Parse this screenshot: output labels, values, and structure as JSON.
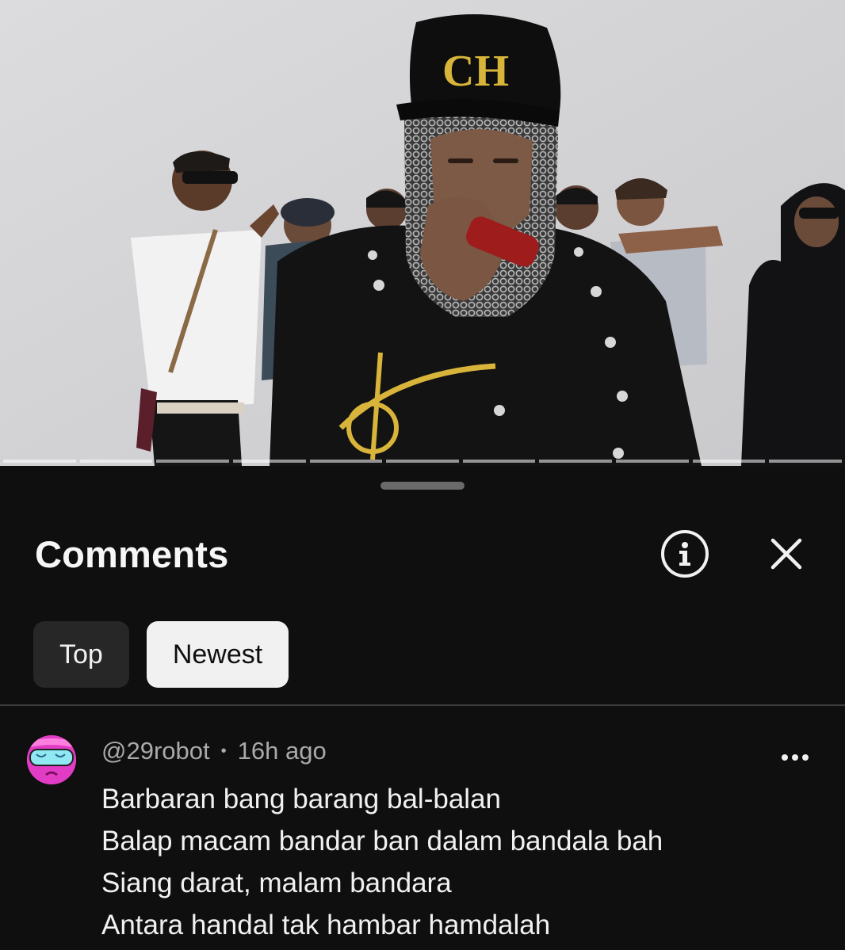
{
  "video": {
    "cap_logo": "CH"
  },
  "comments_panel": {
    "title": "Comments",
    "info_icon": "info-circle-icon",
    "close_icon": "close-x-icon",
    "sort_chips": [
      {
        "label": "Top",
        "selected": false
      },
      {
        "label": "Newest",
        "selected": true
      }
    ],
    "comment": {
      "author": "@29robot",
      "separator": "•",
      "time": "16h ago",
      "lines": [
        "Barbaran bang barang bal-balan",
        "Balap macam bandar ban dalam bandala bah",
        "Siang darat, malam bandara",
        "Antara handal tak hambar hamdalah"
      ],
      "more_icon": "more-horizontal-icon"
    }
  },
  "colors": {
    "background": "#0f0f0f",
    "chip_inactive": "#272727",
    "chip_active": "#f1f1f1",
    "meta_text": "#aaaaaa",
    "avatar_pink": "#e23cc4"
  }
}
